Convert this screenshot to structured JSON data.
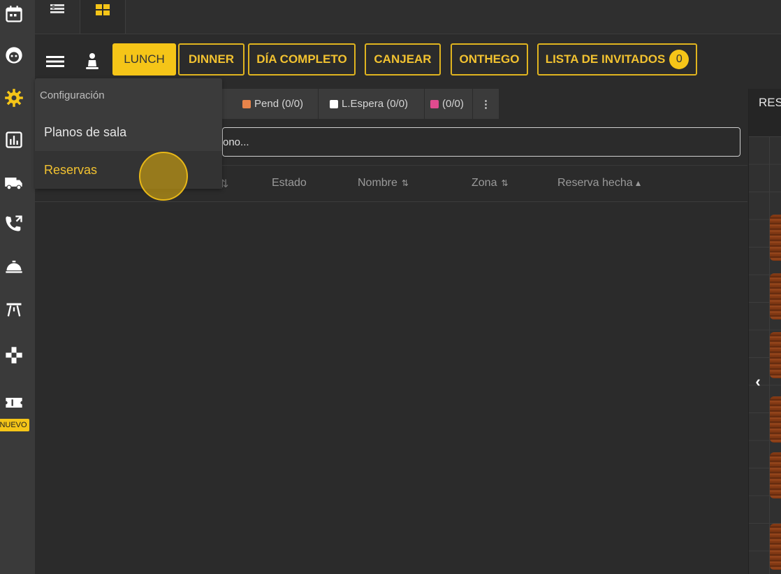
{
  "sidebar": {
    "icons": [
      "calendar-icon",
      "face-icon",
      "gear-icon",
      "bar-chart-icon",
      "truck-icon",
      "phone-transfer-icon",
      "room-service-icon",
      "table-icon",
      "gamepad-icon",
      "ticket-icon"
    ],
    "badge": "NUEVO"
  },
  "topbar": {
    "tabs": [
      "list-view-icon",
      "grid-view-icon"
    ]
  },
  "toolbar": {
    "buttons": [
      "LUNCH",
      "DINNER",
      "DÍA COMPLETO",
      "CANJEAR",
      "ONTHEGO",
      "LISTA DE INVITADOS"
    ],
    "active": "LUNCH",
    "guest_count": "0"
  },
  "filters": {
    "pend": "Pend (0/0)",
    "espera": "L.Espera (0/0)",
    "other": "(0/0)",
    "more": "⋮",
    "colors": {
      "pend": "#e8844a",
      "espera": "#ffffff",
      "other": "#e04b8f"
    }
  },
  "search": {
    "visible_text": "ono..."
  },
  "table": {
    "headers": {
      "estado": "Estado",
      "nombre": "Nombre",
      "zona": "Zona",
      "reserva": "Reserva hecha"
    },
    "sort_both": "⇅",
    "sort_asc": "▲"
  },
  "right_panel": {
    "title": "RES",
    "collapse": "‹"
  },
  "dropdown": {
    "header": "Configuración",
    "items": [
      "Planos de sala",
      "Reservas"
    ],
    "active": "Reservas"
  },
  "colors": {
    "accent": "#f5c518",
    "background": "#2b2b2b",
    "sidebar": "#3a3a3a"
  }
}
